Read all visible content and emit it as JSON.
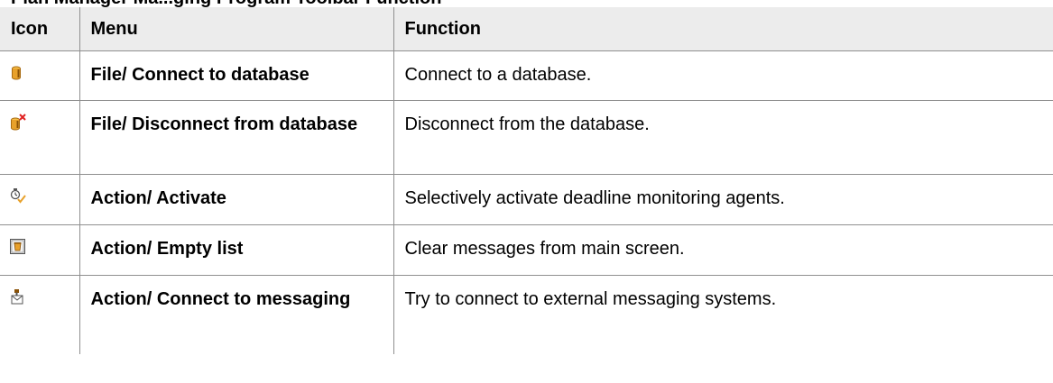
{
  "heading": "Plan Manager Ma...ging Program Toolbar Function",
  "table": {
    "headers": {
      "icon": "Icon",
      "menu": "Menu",
      "function": "Function"
    },
    "rows": [
      {
        "icon": "database-connect-icon",
        "menu": "File/ Connect to database",
        "function": "Connect to a database."
      },
      {
        "icon": "database-disconnect-icon",
        "menu": "File/ Disconnect from database",
        "function": "Disconnect from the database."
      },
      {
        "icon": "activate-agent-icon",
        "menu": "Action/ Activate",
        "function": "Selectively activate deadline monitoring agents."
      },
      {
        "icon": "empty-list-icon",
        "menu": "Action/ Empty list",
        "function": "Clear messages from main screen."
      },
      {
        "icon": "connect-messaging-icon",
        "menu": "Action/ Connect to messaging",
        "function": "Try to connect to external messaging systems."
      }
    ]
  },
  "colors": {
    "header_bg": "#ececec",
    "border": "#8f8f8f",
    "db_orange": "#e8a12b",
    "red_x": "#e02020"
  }
}
